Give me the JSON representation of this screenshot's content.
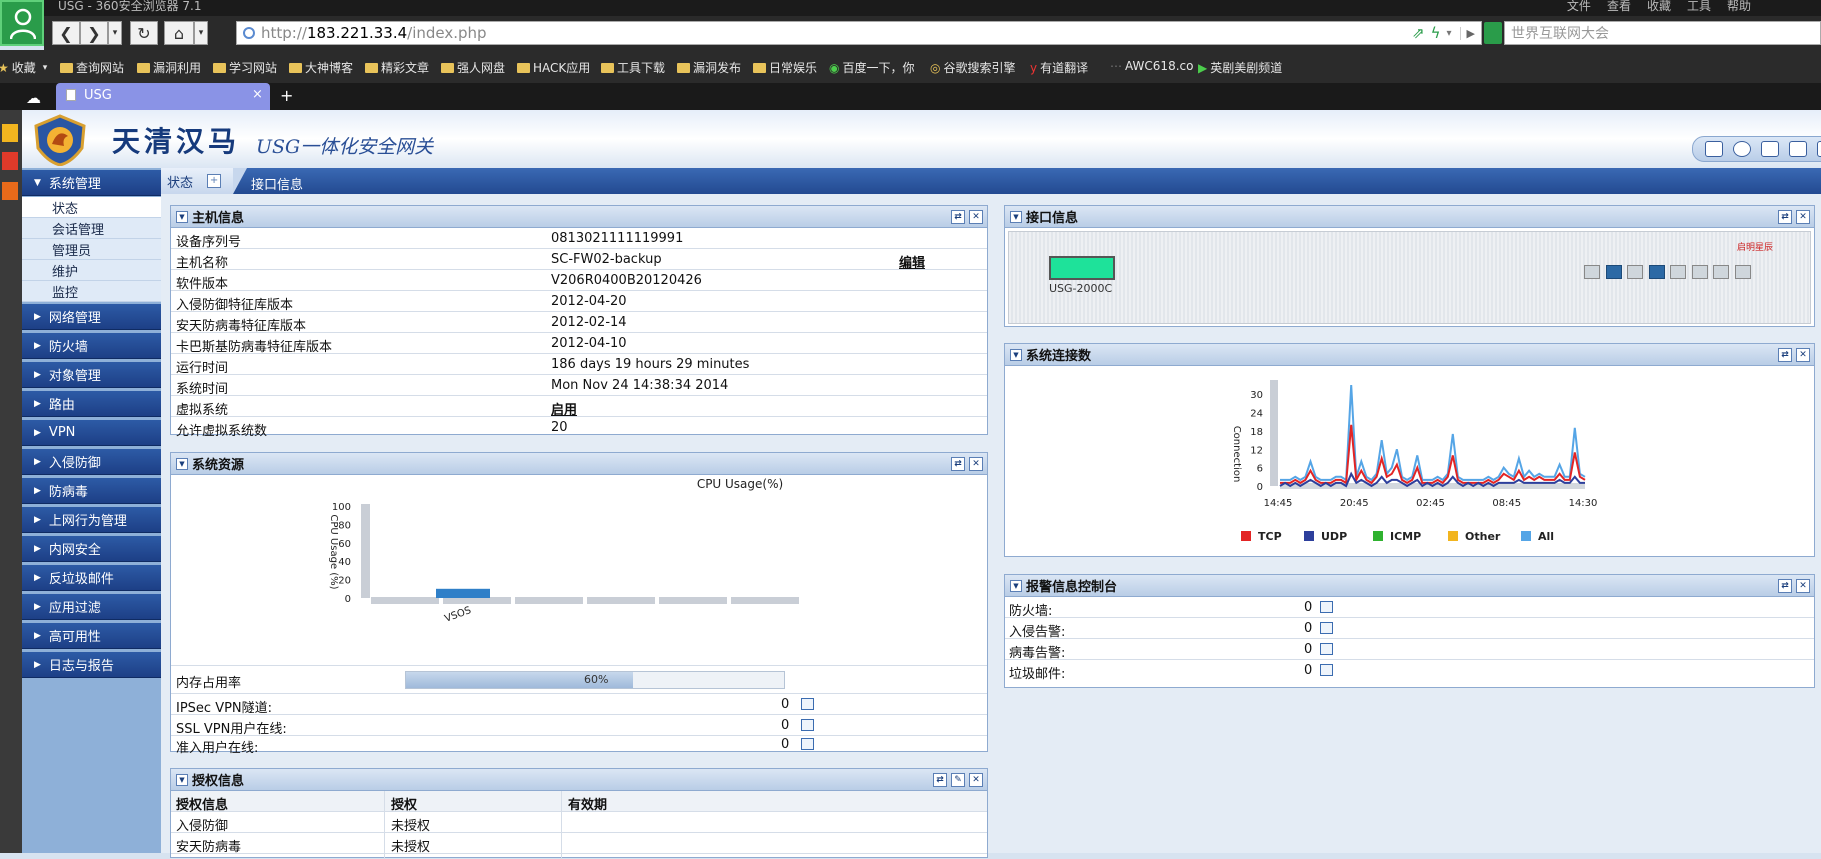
{
  "browser": {
    "window_title": "USG - 360安全浏览器 7.1",
    "top_menu": [
      "文件",
      "查看",
      "收藏",
      "工具",
      "帮助"
    ],
    "url_prefix": "http://",
    "url_host": "183.221.33.4",
    "url_path": "/index.php",
    "search_placeholder": "世界互联网大会",
    "bookmarks": [
      "收藏",
      "查询网站",
      "漏洞利用",
      "学习网站",
      "大神博客",
      "精彩文章",
      "强人网盘",
      "HACK应用",
      "工具下载",
      "漏洞发布",
      "日常娱乐",
      "百度一下，你",
      "谷歌搜索引擎",
      "有道翻译",
      "AWC618.co",
      "英剧美剧频道"
    ],
    "tab_title": "USG"
  },
  "header": {
    "brand": "天清汉马",
    "subtitle": "USG一体化安全网关"
  },
  "sidebar": {
    "sections": [
      "系统管理",
      "网络管理",
      "防火墙",
      "对象管理",
      "路由",
      "VPN",
      "入侵防御",
      "防病毒",
      "上网行为管理",
      "内网安全",
      "反垃圾邮件",
      "应用过滤",
      "高可用性",
      "日志与报告"
    ],
    "sub_items": [
      "状态",
      "会话管理",
      "管理员",
      "维护",
      "监控"
    ]
  },
  "content_tabs": [
    "状态",
    "接口信息"
  ],
  "host_panel": {
    "title": "主机信息",
    "rows": [
      {
        "label": "设备序列号",
        "value": "0813021111119991"
      },
      {
        "label": "主机名称",
        "value": "SC-FW02-backup",
        "action": "编辑"
      },
      {
        "label": "软件版本",
        "value": "V206R0400B20120426"
      },
      {
        "label": "入侵防御特征库版本",
        "value": "2012-04-20"
      },
      {
        "label": "安天防病毒特征库版本",
        "value": "2012-02-14"
      },
      {
        "label": "卡巴斯基防病毒特征库版本",
        "value": "2012-04-10"
      },
      {
        "label": "运行时间",
        "value": "186 days 19 hours 29 minutes"
      },
      {
        "label": "系统时间",
        "value": "Mon Nov 24 14:38:34 2014"
      },
      {
        "label": "虚拟系统",
        "value": "启用"
      },
      {
        "label": "允许虚拟系统数",
        "value": "20"
      }
    ]
  },
  "resource_panel": {
    "title": "系统资源",
    "memory_label": "内存占用率",
    "memory_pct": 60,
    "memory_text": "60%",
    "rows": [
      {
        "label": "IPSec VPN隧道:",
        "value": "0"
      },
      {
        "label": "SSL VPN用户在线:",
        "value": "0"
      },
      {
        "label": "准入用户在线:",
        "value": "0"
      }
    ]
  },
  "license_panel": {
    "title": "授权信息",
    "headers": [
      "授权信息",
      "授权",
      "有效期"
    ],
    "rows": [
      {
        "name": "入侵防御",
        "auth": "未授权",
        "expiry": ""
      },
      {
        "name": "安天防病毒",
        "auth": "未授权",
        "expiry": ""
      }
    ]
  },
  "iface_panel": {
    "title": "接口信息",
    "device_name": "USG-2000C",
    "vendor_mark": "启明星辰",
    "ports_active": [
      false,
      true,
      false,
      true,
      false,
      false,
      false,
      false
    ]
  },
  "conn_panel": {
    "title": "系统连接数"
  },
  "alert_panel": {
    "title": "报警信息控制台",
    "rows": [
      {
        "label": "防火墙:",
        "value": "0"
      },
      {
        "label": "入侵告警:",
        "value": "0"
      },
      {
        "label": "病毒告警:",
        "value": "0"
      },
      {
        "label": "垃圾邮件:",
        "value": "0"
      }
    ]
  },
  "colors": {
    "tcp": "#e32424",
    "udp": "#2d3f9c",
    "icmp": "#2fb22f",
    "other": "#f2b51f",
    "all": "#55a5e6",
    "sidebar_header": "#2d5ba6"
  },
  "chart_data": [
    {
      "type": "bar",
      "title": "CPU Usage(%)",
      "ylabel": "CPU Usage (%)",
      "categories": [
        "VSOS"
      ],
      "values": [
        10
      ],
      "ylim": [
        0,
        100
      ],
      "yticks": [
        0,
        20,
        40,
        60,
        80,
        100
      ]
    },
    {
      "type": "line",
      "ylabel": "Connection",
      "xticks": [
        "14:45",
        "20:45",
        "02:45",
        "08:45",
        "14:30"
      ],
      "yticks": [
        0,
        6,
        12,
        18,
        24,
        30
      ],
      "ylim": [
        0,
        34
      ],
      "legend": [
        "TCP",
        "UDP",
        "ICMP",
        "Other",
        "All"
      ],
      "series": [
        {
          "name": "All",
          "values": [
            2,
            2,
            2,
            3,
            2,
            3,
            8,
            3,
            2,
            2,
            2,
            3,
            3,
            2,
            33,
            3,
            8,
            3,
            2,
            4,
            15,
            4,
            6,
            12,
            3,
            2,
            3,
            10,
            2,
            2,
            2,
            3,
            2,
            4,
            17,
            3,
            2,
            2,
            2,
            2,
            2,
            3,
            2,
            3,
            6,
            4,
            3,
            9,
            3,
            5,
            3,
            4,
            3,
            3,
            3,
            7,
            3,
            3,
            19,
            4,
            3
          ]
        },
        {
          "name": "TCP",
          "values": [
            1,
            1,
            1,
            2,
            1,
            2,
            5,
            2,
            1,
            1,
            1,
            2,
            2,
            1,
            20,
            2,
            5,
            2,
            1,
            3,
            9,
            3,
            4,
            7,
            2,
            1,
            2,
            6,
            1,
            1,
            1,
            2,
            1,
            3,
            10,
            2,
            1,
            1,
            1,
            1,
            1,
            2,
            1,
            2,
            4,
            3,
            2,
            5,
            2,
            3,
            2,
            3,
            2,
            2,
            2,
            4,
            2,
            2,
            11,
            3,
            2
          ]
        },
        {
          "name": "UDP",
          "values": [
            0,
            1,
            0,
            1,
            0,
            1,
            2,
            1,
            0,
            1,
            0,
            1,
            1,
            0,
            4,
            1,
            2,
            1,
            0,
            1,
            3,
            1,
            2,
            2,
            1,
            0,
            1,
            2,
            0,
            1,
            0,
            1,
            0,
            1,
            3,
            1,
            0,
            1,
            0,
            1,
            0,
            1,
            0,
            1,
            1,
            1,
            1,
            2,
            1,
            1,
            1,
            1,
            1,
            1,
            1,
            2,
            1,
            1,
            3,
            1,
            1
          ]
        }
      ]
    }
  ]
}
